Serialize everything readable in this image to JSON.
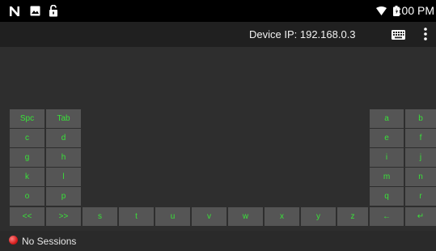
{
  "status_bar": {
    "time": "1:00 PM"
  },
  "toolbar": {
    "title": "Device IP: 192.168.0.3"
  },
  "keys": {
    "spc": "Spc",
    "tab": "Tab",
    "c": "c",
    "d": "d",
    "g": "g",
    "h": "h",
    "k": "k",
    "l": "l",
    "o": "o",
    "p": "p",
    "prev": "<<",
    "next": ">>",
    "s": "s",
    "t": "t",
    "u": "u",
    "v": "v",
    "w": "w",
    "x": "x",
    "y": "y",
    "z": "z",
    "a": "a",
    "b": "b",
    "e": "e",
    "f": "f",
    "i": "i",
    "j": "j",
    "m": "m",
    "n": "n",
    "q": "q",
    "r": "r",
    "backspace": "←",
    "enter": "↵"
  },
  "session": {
    "status": "No Sessions"
  },
  "colors": {
    "key_text": "#39e239",
    "key_bg": "#555555",
    "status_dot": "#d62020"
  }
}
